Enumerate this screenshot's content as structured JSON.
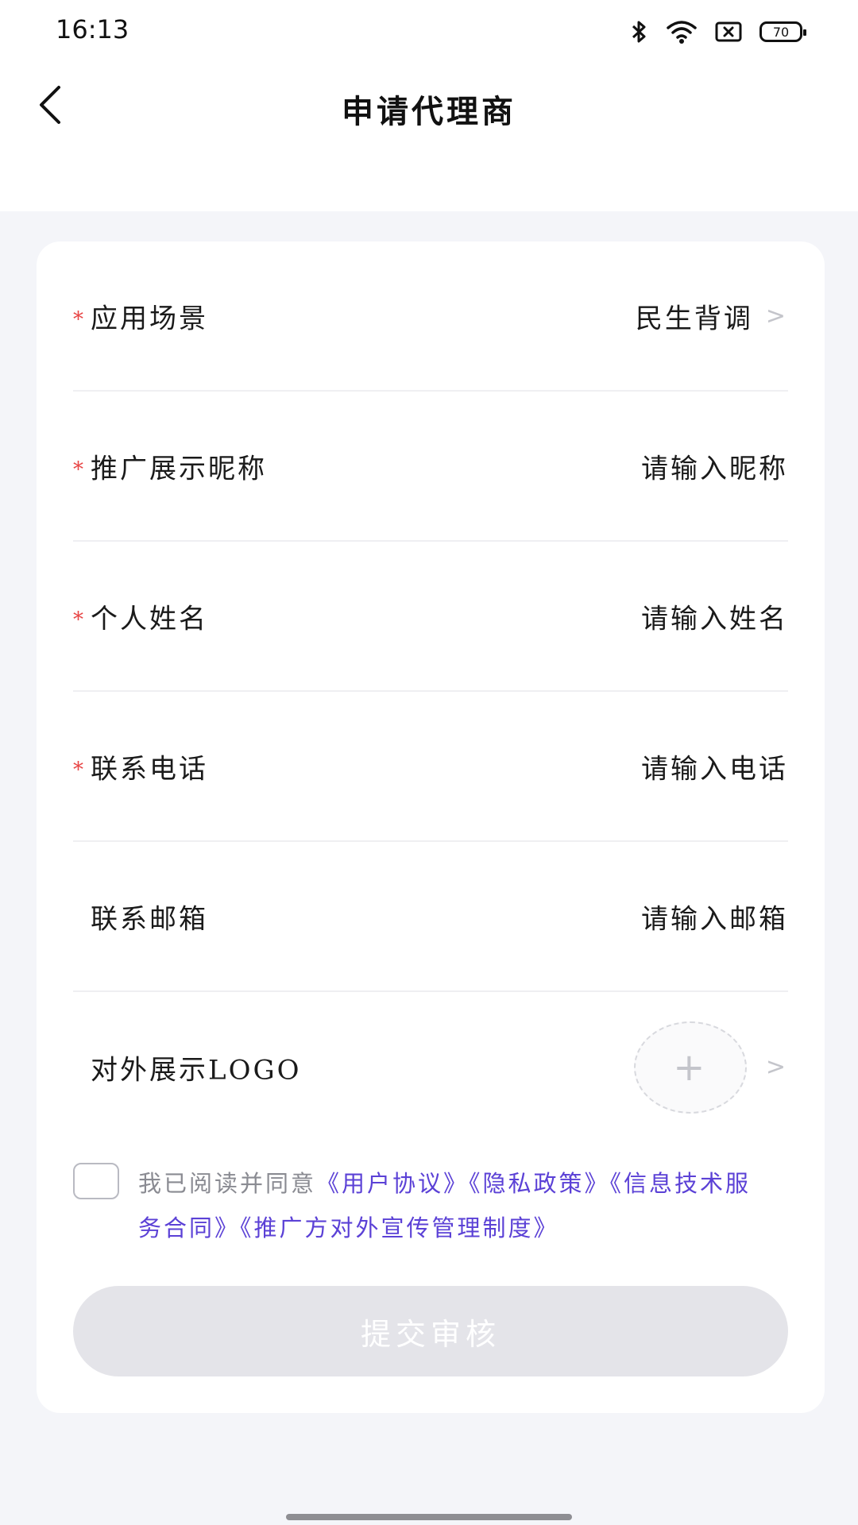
{
  "status_bar": {
    "time": "16:13",
    "battery": "70",
    "icons": [
      "bluetooth-icon",
      "wifi-icon",
      "sim-off-icon",
      "battery-icon"
    ]
  },
  "header": {
    "title": "申请代理商"
  },
  "form": {
    "rows": [
      {
        "label": "应用场景",
        "required": true,
        "value": "民生背调",
        "chevron": ">"
      },
      {
        "label": "推广展示昵称",
        "required": true,
        "placeholder": "请输入昵称"
      },
      {
        "label": "个人姓名",
        "required": true,
        "placeholder": "请输入姓名"
      },
      {
        "label": "联系电话",
        "required": true,
        "placeholder": "请输入电话"
      },
      {
        "label": "联系邮箱",
        "required": false,
        "placeholder": "请输入邮箱"
      },
      {
        "label": "对外展示LOGO",
        "required": false,
        "upload_symbol": "+",
        "chevron": ">"
      }
    ],
    "required_mark": "*"
  },
  "agreement": {
    "prefix": "我已阅读并同意",
    "links": [
      "《用户协议》",
      "《隐私政策》",
      "《信息技术服务合同》",
      "《推广方对外宣传管理制度》"
    ],
    "checked": false
  },
  "submit": {
    "label": "提交审核",
    "enabled": false
  },
  "colors": {
    "required": "#e84545",
    "link": "#5b41d6",
    "background": "#f4f5f9",
    "button_disabled": "#e4e4e9"
  }
}
